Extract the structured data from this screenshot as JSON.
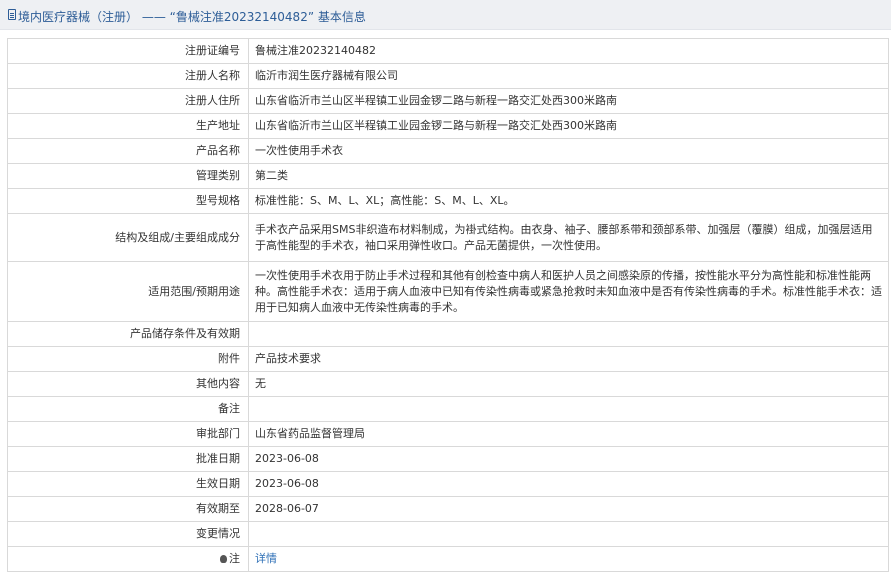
{
  "header": {
    "title": "境内医疗器械（注册） —— “鲁械注准20232140482” 基本信息"
  },
  "rows": [
    {
      "label": "注册证编号",
      "value": "鲁械注准20232140482"
    },
    {
      "label": "注册人名称",
      "value": "临沂市润生医疗器械有限公司"
    },
    {
      "label": "注册人住所",
      "value": "山东省临沂市兰山区半程镇工业园金锣二路与新程一路交汇处西300米路南"
    },
    {
      "label": "生产地址",
      "value": "山东省临沂市兰山区半程镇工业园金锣二路与新程一路交汇处西300米路南"
    },
    {
      "label": "产品名称",
      "value": "一次性使用手术衣"
    },
    {
      "label": "管理类别",
      "value": "第二类"
    },
    {
      "label": "型号规格",
      "value": "标准性能：S、M、L、XL；高性能：S、M、L、XL。"
    },
    {
      "label": "结构及组成/主要组成成分",
      "value": "手术衣产品采用SMS非织造布材料制成，为褂式结构。由衣身、袖子、腰部系带和颈部系带、加强层（覆膜）组成，加强层适用于高性能型的手术衣，袖口采用弹性收口。产品无菌提供，一次性使用。"
    },
    {
      "label": "适用范围/预期用途",
      "value": "一次性使用手术衣用于防止手术过程和其他有创检查中病人和医护人员之间感染原的传播，按性能水平分为高性能和标准性能两种。高性能手术衣：适用于病人血液中已知有传染性病毒或紧急抢救时未知血液中是否有传染性病毒的手术。标准性能手术衣：适用于已知病人血液中无传染性病毒的手术。"
    },
    {
      "label": "产品储存条件及有效期",
      "value": ""
    },
    {
      "label": "附件",
      "value": "产品技术要求"
    },
    {
      "label": "其他内容",
      "value": "无"
    },
    {
      "label": "备注",
      "value": ""
    },
    {
      "label": "审批部门",
      "value": "山东省药品监督管理局"
    },
    {
      "label": "批准日期",
      "value": "2023-06-08"
    },
    {
      "label": "生效日期",
      "value": "2023-06-08"
    },
    {
      "label": "有效期至",
      "value": "2028-06-07"
    },
    {
      "label": "变更情况",
      "value": ""
    }
  ],
  "note": {
    "label": "注",
    "link": "详情"
  }
}
